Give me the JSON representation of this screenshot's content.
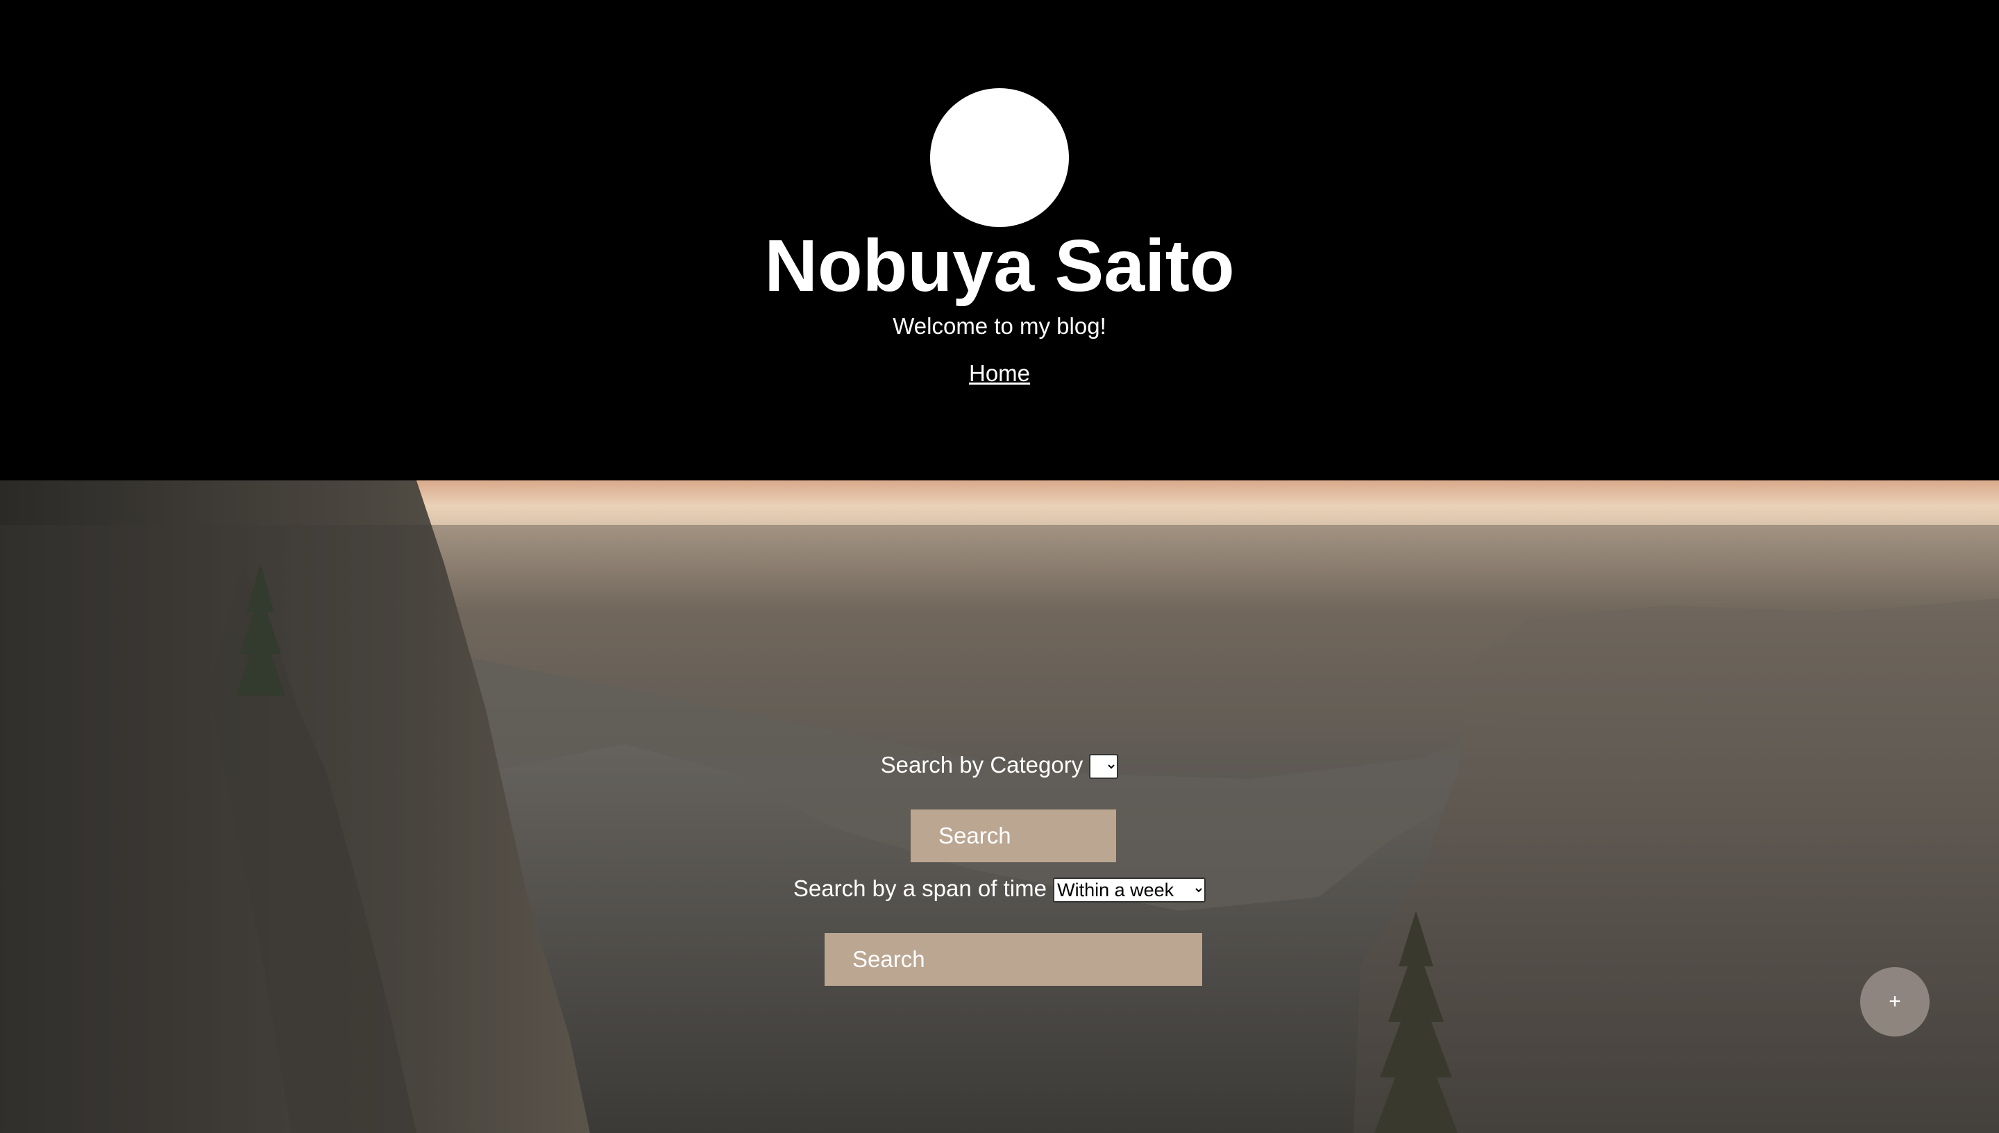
{
  "header": {
    "avatar_color": "#ffffff",
    "title": "Nobuya Saito",
    "tagline": "Welcome to my blog!",
    "nav": {
      "home_label": "Home"
    }
  },
  "search": {
    "category_label": "Search by Category",
    "category_selected": "",
    "category_button": "Search",
    "time_label": "Search by a span of time",
    "time_selected": "Within a week",
    "time_button": "Search",
    "button_color": "#bba692"
  },
  "fab": {
    "label": "+"
  }
}
